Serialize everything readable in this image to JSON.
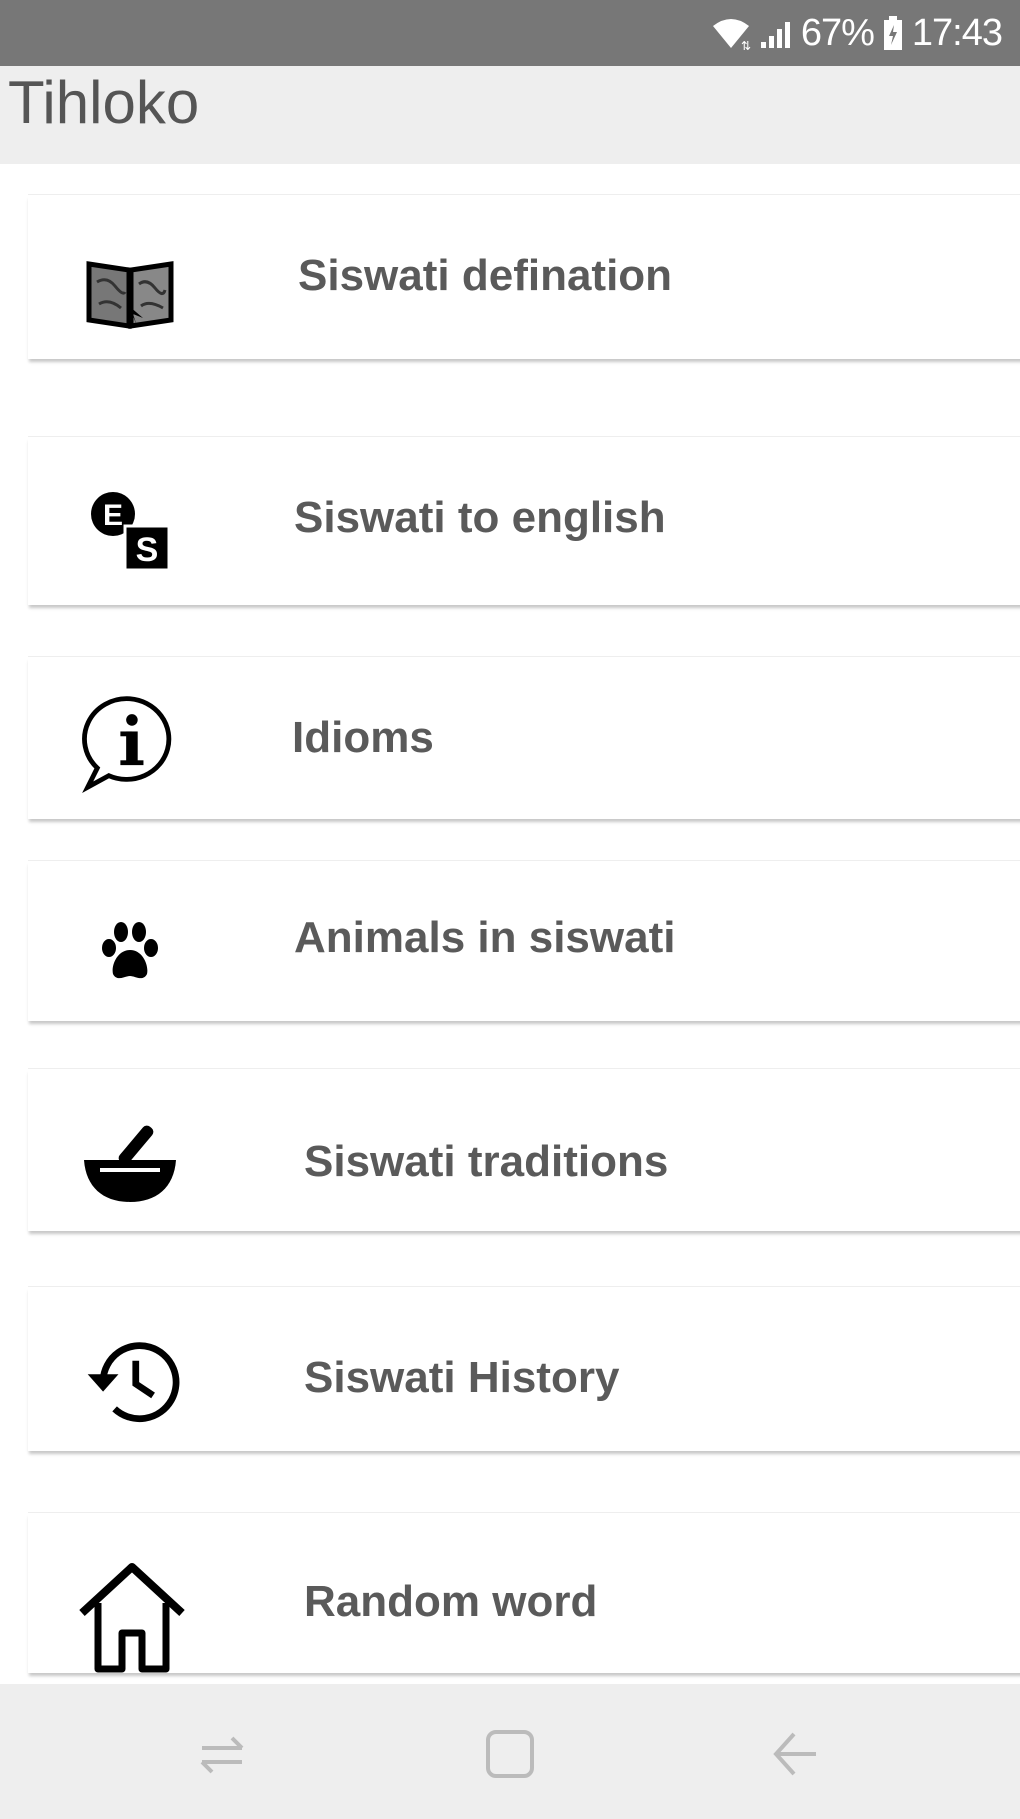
{
  "status_bar": {
    "battery": "67%",
    "time": "17:43"
  },
  "app_bar": {
    "title": "Tihloko"
  },
  "menu": {
    "items": [
      {
        "label": "Siswati defination",
        "icon": "book-map-icon"
      },
      {
        "label": "Siswati to english",
        "icon": "translate-icon"
      },
      {
        "label": "Idioms",
        "icon": "info-bubble-icon"
      },
      {
        "label": "Animals in siswati",
        "icon": "paw-icon"
      },
      {
        "label": "Siswati traditions",
        "icon": "mortar-pestle-icon"
      },
      {
        "label": "Siswati History",
        "icon": "history-icon"
      },
      {
        "label": "Random word",
        "icon": "home-icon"
      }
    ]
  },
  "nav_bar": {
    "buttons": [
      "recent-apps-icon",
      "home-square-icon",
      "back-arrow-icon"
    ]
  }
}
